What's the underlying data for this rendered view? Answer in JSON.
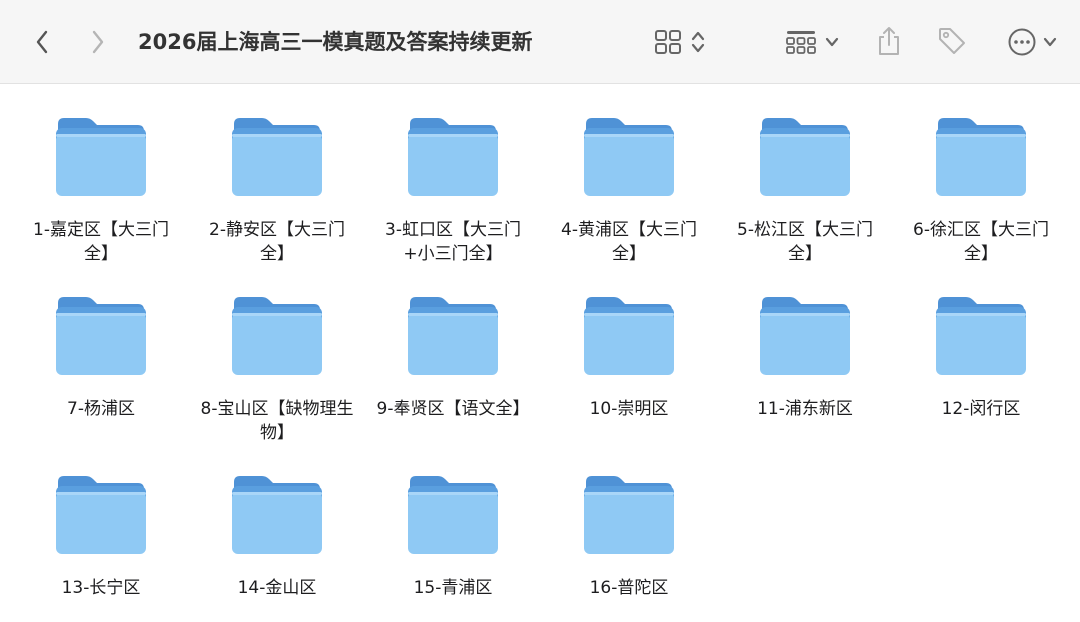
{
  "window": {
    "title": "2026届上海高三一模真题及答案持续更新"
  },
  "toolbar": {
    "back": {
      "icon": "chevron-left-icon"
    },
    "forward": {
      "icon": "chevron-right-icon"
    },
    "view_mode": {
      "icon": "grid-view-icon"
    },
    "group_by": {
      "icon": "group-by-icon"
    },
    "share": {
      "icon": "share-icon"
    },
    "tags": {
      "icon": "tag-icon"
    },
    "more": {
      "icon": "more-icon"
    }
  },
  "colors": {
    "folder_body": "#8fc9f4",
    "folder_back": "#5a9fdf",
    "folder_tab": "#4f92d6"
  },
  "folders": [
    {
      "name": "1-嘉定区【大三门全】"
    },
    {
      "name": "2-静安区【大三门全】"
    },
    {
      "name": "3-虹口区【大三门+小三门全】"
    },
    {
      "name": "4-黄浦区【大三门全】"
    },
    {
      "name": "5-松江区【大三门全】"
    },
    {
      "name": "6-徐汇区【大三门全】"
    },
    {
      "name": "7-杨浦区"
    },
    {
      "name": "8-宝山区【缺物理生物】"
    },
    {
      "name": "9-奉贤区【语文全】"
    },
    {
      "name": "10-崇明区"
    },
    {
      "name": "11-浦东新区"
    },
    {
      "name": "12-闵行区"
    },
    {
      "name": "13-长宁区"
    },
    {
      "name": "14-金山区"
    },
    {
      "name": "15-青浦区"
    },
    {
      "name": "16-普陀区"
    }
  ]
}
